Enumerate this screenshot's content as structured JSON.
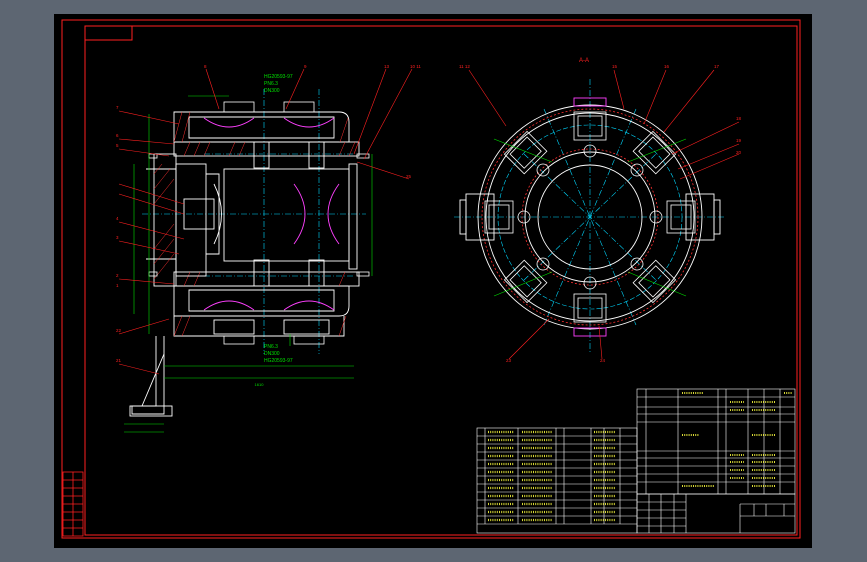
{
  "colors": {
    "background": "#5d6672",
    "sheet": "#000000",
    "frame": "#ff2020",
    "outline": "#ffffff",
    "dimension": "#00e000",
    "leader": "#ff2020",
    "centerline": "#00d8ff",
    "hatch": "#ff3030",
    "text": "#ffffff",
    "magenta": "#ff40ff",
    "yellow": "#ffff40"
  },
  "section_label": "A-A",
  "front_view_notes": {
    "spec_top": [
      "HG20593-97",
      "PN6.3",
      "DN300"
    ],
    "spec_bottom": [
      "PN6.3",
      "DN300",
      "HG20593-97"
    ],
    "dim_length": "1610"
  },
  "part_balloons": [
    "8",
    "9",
    "13",
    "10 11",
    "11 12",
    "15",
    "16",
    "17",
    "18",
    "19",
    "20",
    "7",
    "6",
    "5",
    "4",
    "3",
    "2",
    "1",
    "22",
    "21",
    "23",
    "24",
    "25"
  ],
  "tables": {
    "parts_list_rows": 12,
    "spec_rows": 8,
    "title_block_cells": 6
  }
}
